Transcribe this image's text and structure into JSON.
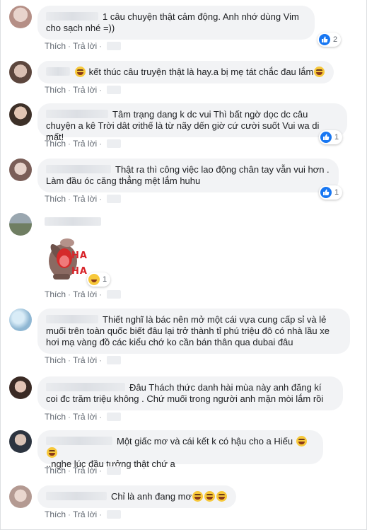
{
  "actions": {
    "like": "Thích",
    "reply": "Trả lời"
  },
  "comments": [
    {
      "text": "1 câu chuyện thật cảm động. Anh nhớ dùng Vim cho sạch nhé =))",
      "reactions": "2",
      "avatar_color": "#c9a7a0"
    },
    {
      "text": "kết thúc câu truyện thật là hay.a bị mẹ tát chắc đau lắm",
      "avatar_color": "#8a6b5e"
    },
    {
      "text": "Tâm trạng dang k dc vui Thì bất ngờ dọc dc câu chuyện a kê Trời dât ơithế là từ nãy dến giờ cứ cười suốt Vui wa di mất!",
      "reactions": "1",
      "avatar_color": "#6d5a4f"
    },
    {
      "text": "Thật ra thì công việc lao động chân tay vẫn vui hơn . Làm đầu óc căng thẳng mệt lắm huhu",
      "reactions": "1",
      "avatar_color": "#a08a88"
    },
    {
      "sticker_text": "HA HA",
      "reactions": "1",
      "avatar_color": "#7c8a76"
    },
    {
      "text": "Thiết nghĩ là bác nên mở một cái vựa cung cấp sỉ và lẻ muối trên toàn quốc biết đâu lại trở thành tỉ phú triệu đô có nhà lầu xe hơi mạ vàng đồ các kiểu chớ ko cần bán thân qua dubai đâu",
      "avatar_color": "#9fc3da"
    },
    {
      "text": "Đâu Thách thức danh hài mùa này anh đăng kí coi đc trăm triệu không . Chứ muối trong người anh mặn mòi lắm rồi",
      "avatar_color": "#6b4e44"
    },
    {
      "text": "Một giấc mơ và cái kết k có hậu cho a Hiếu",
      "text2": "..nghe lúc đầu tưởng thật chứ a",
      "avatar_color": "#4e5866"
    },
    {
      "text": "Chỉ là anh đang mơ",
      "avatar_color": "#c9b6ad"
    }
  ],
  "colors": {
    "like_blue": "#1877f2",
    "bubble_bg": "#f2f3f5",
    "action_text": "#606770",
    "haha_yellow": "#f7c83a"
  }
}
